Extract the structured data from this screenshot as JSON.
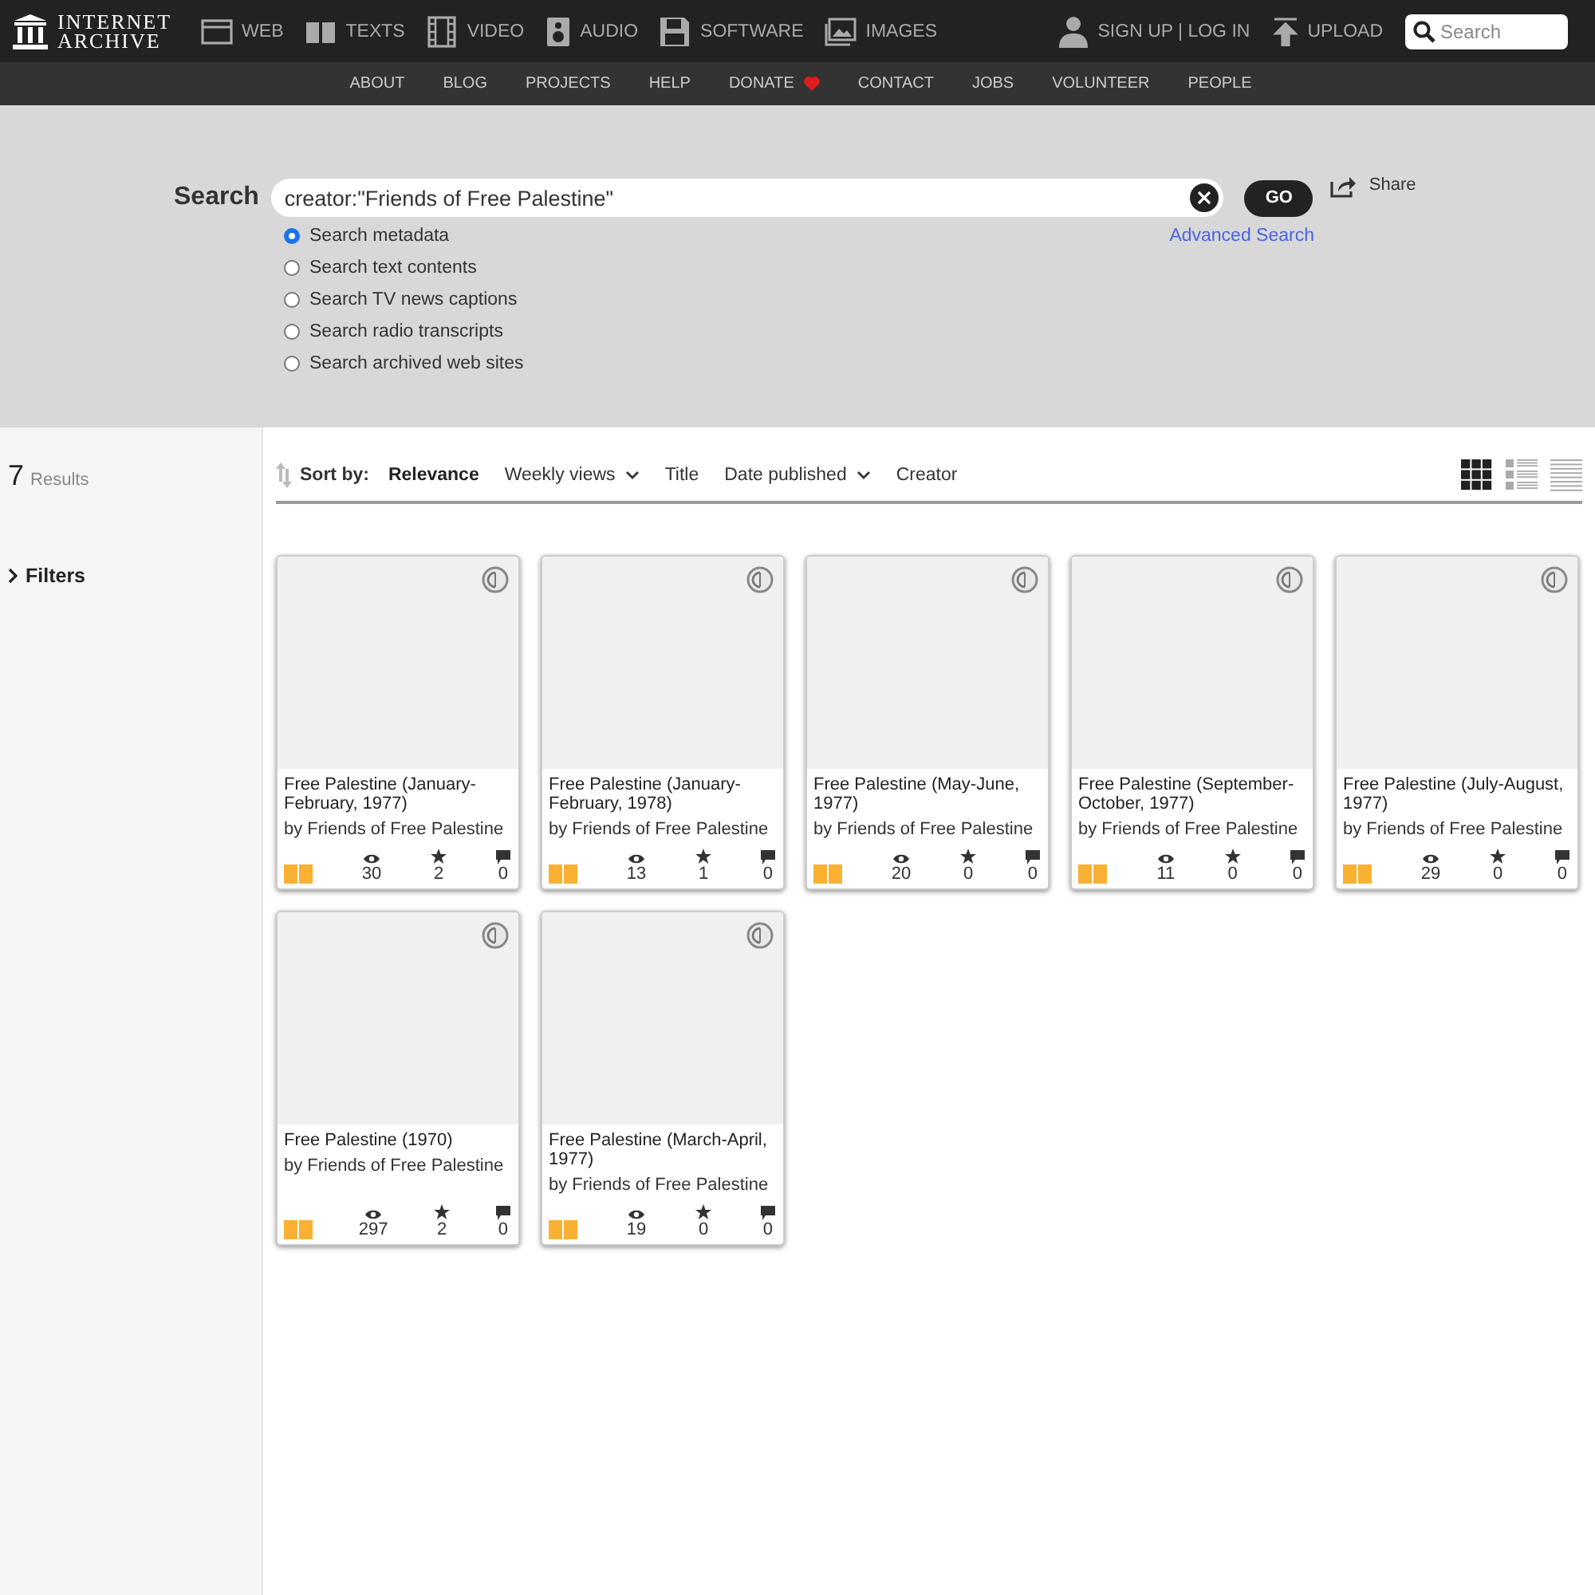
{
  "logo": {
    "line_1": "INTERNET",
    "line_2": "ARCHIVE"
  },
  "media_nav": [
    {
      "kind": "web",
      "label": "WEB"
    },
    {
      "kind": "texts",
      "label": "TEXTS"
    },
    {
      "kind": "video",
      "label": "VIDEO"
    },
    {
      "kind": "audio",
      "label": "AUDIO"
    },
    {
      "kind": "software",
      "label": "SOFTWARE"
    },
    {
      "kind": "images",
      "label": "IMAGES"
    }
  ],
  "account": {
    "sign_in": "SIGN UP | LOG IN",
    "upload": "UPLOAD",
    "search_placeholder": "Search"
  },
  "sub_nav": [
    {
      "label": "ABOUT",
      "heart": false
    },
    {
      "label": "BLOG",
      "heart": false
    },
    {
      "label": "PROJECTS",
      "heart": false
    },
    {
      "label": "HELP",
      "heart": false
    },
    {
      "label": "DONATE",
      "heart": true
    },
    {
      "label": "CONTACT",
      "heart": false
    },
    {
      "label": "JOBS",
      "heart": false
    },
    {
      "label": "VOLUNTEER",
      "heart": false
    },
    {
      "label": "PEOPLE",
      "heart": false
    }
  ],
  "search": {
    "label": "Search",
    "value": "creator:\"Friends of Free Palestine\"",
    "go": "GO",
    "share": "Share",
    "advanced": "Advanced Search",
    "options": [
      {
        "label": "Search metadata",
        "selected": true
      },
      {
        "label": "Search text contents",
        "selected": false
      },
      {
        "label": "Search TV news captions",
        "selected": false
      },
      {
        "label": "Search radio transcripts",
        "selected": false
      },
      {
        "label": "Search archived web sites",
        "selected": false
      }
    ]
  },
  "results": {
    "count": "7",
    "label": "Results",
    "filters": "Filters"
  },
  "sort": {
    "label": "Sort by:",
    "options": [
      {
        "label": "Relevance",
        "selected": true,
        "dropdown": false
      },
      {
        "label": "Weekly views",
        "selected": false,
        "dropdown": true
      },
      {
        "label": "Title",
        "selected": false,
        "dropdown": false
      },
      {
        "label": "Date published",
        "selected": false,
        "dropdown": true
      },
      {
        "label": "Creator",
        "selected": false,
        "dropdown": false
      }
    ],
    "view_modes": [
      {
        "kind": "tiles",
        "selected": true
      },
      {
        "kind": "list-detail",
        "selected": false
      },
      {
        "kind": "list-compact",
        "selected": false
      }
    ]
  },
  "items": [
    {
      "title": "Free Palestine (January-February, 1977)",
      "creator": "by Friends of Free Palestine",
      "views": "30",
      "favorites": "2",
      "reviews": "0"
    },
    {
      "title": "Free Palestine (January-February, 1978)",
      "creator": "by Friends of Free Palestine",
      "views": "13",
      "favorites": "1",
      "reviews": "0"
    },
    {
      "title": "Free Palestine (May-June, 1977)",
      "creator": "by Friends of Free Palestine",
      "views": "20",
      "favorites": "0",
      "reviews": "0"
    },
    {
      "title": "Free Palestine (September-October, 1977)",
      "creator": "by Friends of Free Palestine",
      "views": "11",
      "favorites": "0",
      "reviews": "0"
    },
    {
      "title": "Free Palestine (July-August, 1977)",
      "creator": "by Friends of Free Palestine",
      "views": "29",
      "favorites": "0",
      "reviews": "0"
    },
    {
      "title": "Free Palestine (1970)",
      "creator": "by Friends of Free Palestine",
      "views": "297",
      "favorites": "2",
      "reviews": "0"
    },
    {
      "title": "Free Palestine (March-April, 1977)",
      "creator": "by Friends of Free Palestine",
      "views": "19",
      "favorites": "0",
      "reviews": "0"
    }
  ]
}
